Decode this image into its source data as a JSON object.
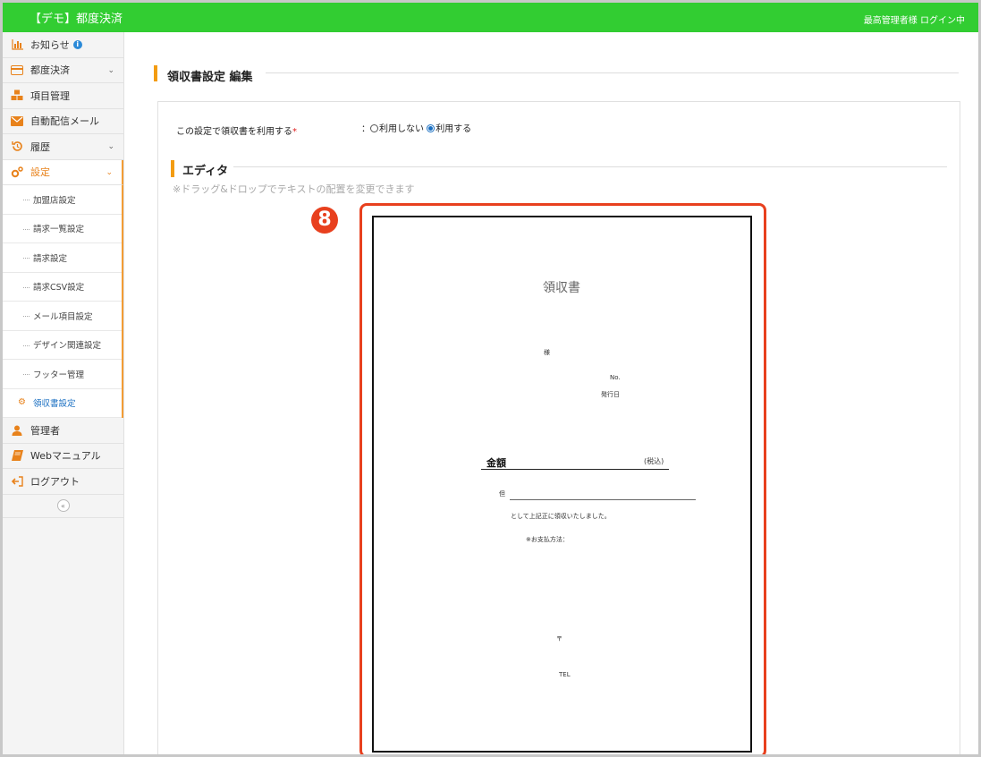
{
  "header": {
    "app_title": "【デモ】都度決済",
    "login_status": "最高管理者様 ログイン中"
  },
  "sidebar": {
    "items": [
      {
        "label": "お知らせ",
        "icon": "bar-chart-icon"
      },
      {
        "label": "都度決済",
        "icon": "credit-card-icon"
      },
      {
        "label": "項目管理",
        "icon": "cubes-icon"
      },
      {
        "label": "自動配信メール",
        "icon": "envelope-icon"
      },
      {
        "label": "履歴",
        "icon": "history-icon"
      },
      {
        "label": "設定",
        "icon": "gears-icon"
      }
    ],
    "settings_sub": [
      "加盟店設定",
      "請求一覧設定",
      "請求設定",
      "請求CSV設定",
      "メール項目設定",
      "デザイン関連設定",
      "フッター管理",
      "領収書設定"
    ],
    "bottom_items": [
      {
        "label": "管理者",
        "icon": "user-icon"
      },
      {
        "label": "Webマニュアル",
        "icon": "book-icon"
      },
      {
        "label": "ログアウト",
        "icon": "sign-out-icon"
      }
    ],
    "collapse_glyph": "«"
  },
  "main": {
    "page_title": "領収書設定 編集",
    "setting": {
      "label": "この設定で領収書を利用する",
      "required_mark": "*",
      "separator": "：",
      "option_off": "利用しない",
      "option_on": "利用する",
      "selected": "利用する"
    },
    "editor_title": "エディタ",
    "editor_hint": "※ドラッグ&ドロップでテキストの配置を変更できます",
    "badge": "8"
  },
  "receipt": {
    "title": "領収書",
    "sama": "様",
    "no": "No.",
    "issue_date": "発行日",
    "amount_label": "金額",
    "tax_note": "(税込)",
    "tadashi": "但",
    "received_text": "として上記正に領収いたしました。",
    "payment_method": "※お支払方法：",
    "postal": "〒",
    "tel": "TEL"
  },
  "colors": {
    "header_bg": "#32cd32",
    "accent": "#f39c12",
    "highlight": "#e8401e",
    "link": "#1a6fc2"
  }
}
